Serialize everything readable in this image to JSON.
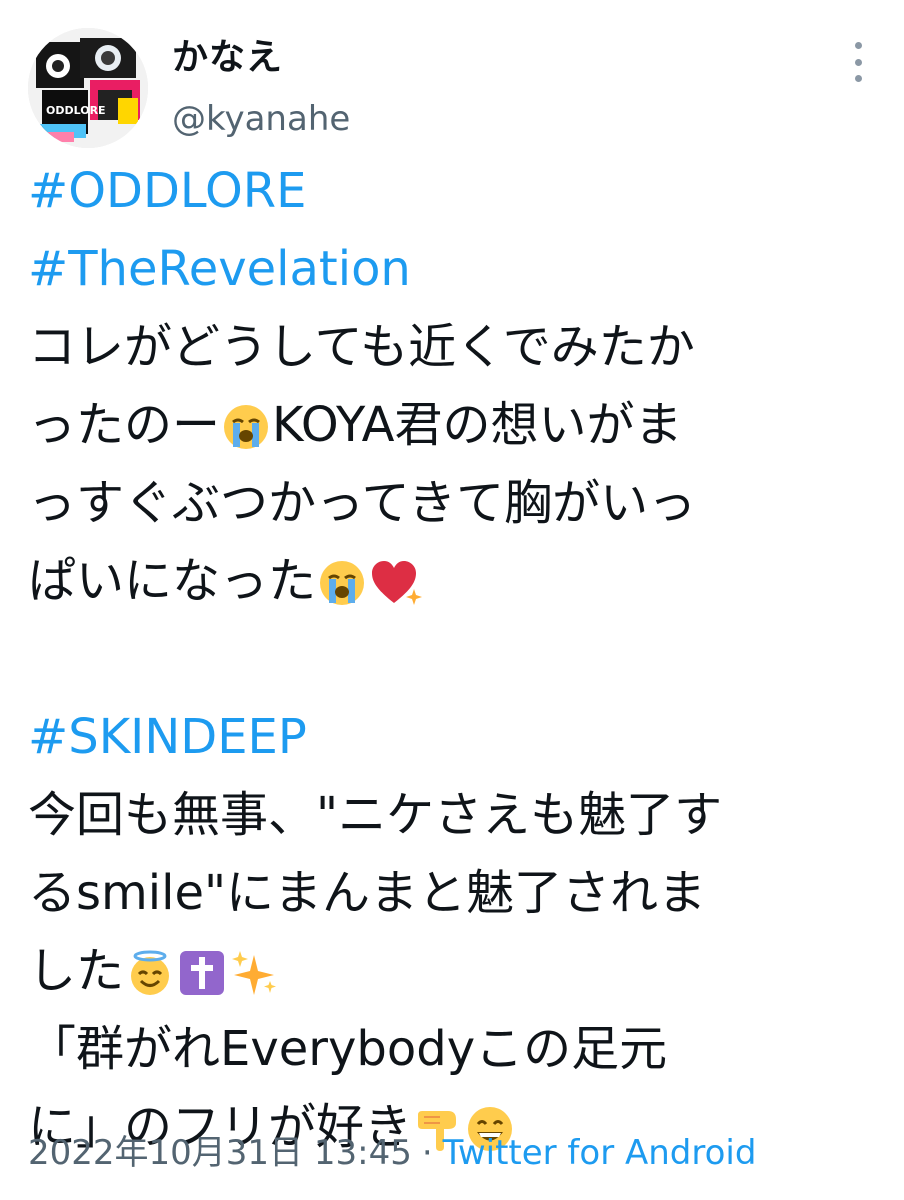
{
  "author": {
    "display_name": "かなえ",
    "handle": "@kyanahe",
    "avatar_text": "ODDLORE"
  },
  "tweet": {
    "hashtag_1": "#ODDLORE",
    "hashtag_2": "#TheRevelation",
    "line_1": "コレがどうしても近くでみたか",
    "line_2a": "ったのー",
    "line_2b": "KOYA君の想いがま",
    "line_3": "っすぐぶつかってきて胸がいっ",
    "line_4": "ぱいになった",
    "hashtag_3": "#SKINDEEP",
    "line_5": "今回も無事、\"ニケさえも魅了す",
    "line_6": "るsmile\"にまんまと魅了されま",
    "line_7": "した",
    "line_8": "「群がれEverybodyこの足元",
    "line_9": "に」のフリが好き"
  },
  "footer": {
    "timestamp": "2022年10月31日 13:45",
    "separator": "·",
    "source": "Twitter for Android"
  },
  "colors": {
    "hashtag": "#1d9bf0",
    "secondary_text": "#536471",
    "text": "#0f1419"
  },
  "icons": [
    "loudly-crying-face-emoji",
    "sparkling-heart-emoji",
    "smiling-face-with-halo-emoji",
    "latin-cross-emoji",
    "sparkles-emoji",
    "backhand-index-pointing-down-emoji",
    "beaming-face-emoji",
    "more-options-icon"
  ]
}
